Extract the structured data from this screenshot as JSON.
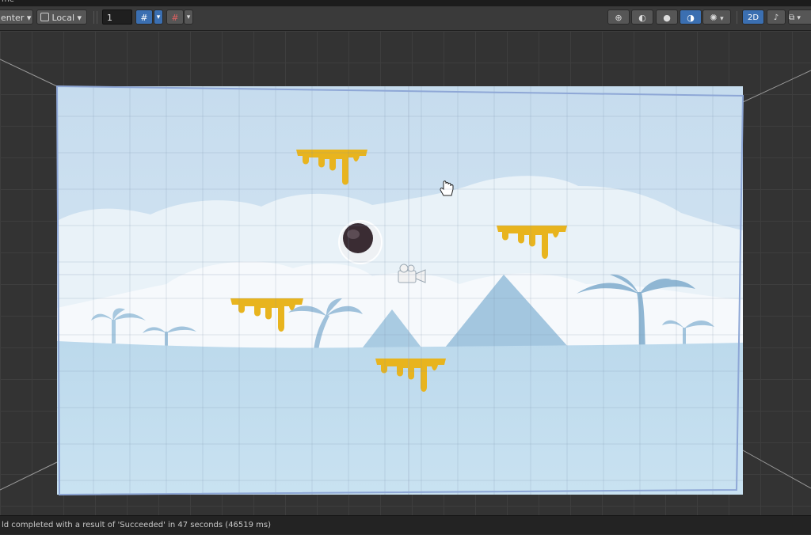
{
  "window": {
    "title_fragment": "me"
  },
  "toolbar": {
    "pivot_label": "enter",
    "space_label": "Local",
    "grid_snap_value": "1",
    "view_2d_label": "2D"
  },
  "scene": {
    "camera_outline_color": "#8ea7d6",
    "sky_color": "#cfe3f1",
    "ground_color": "#b9d8eb",
    "platform_color": "#e8b41e",
    "ball_color": "#3a2c33"
  },
  "icons": [
    "pivot-dropdown-icon",
    "local-cube-icon",
    "grid-snap-icon",
    "increment-snap-icon",
    "global-view-icon",
    "render-mode-icon",
    "lighting-icon",
    "fx-icon",
    "gizmo-icon",
    "scene-camera-icon",
    "hand-cursor-icon",
    "camera-gizmo-icon"
  ],
  "status": {
    "message": "ld completed with a result of 'Succeeded' in 47 seconds (46519 ms)"
  }
}
